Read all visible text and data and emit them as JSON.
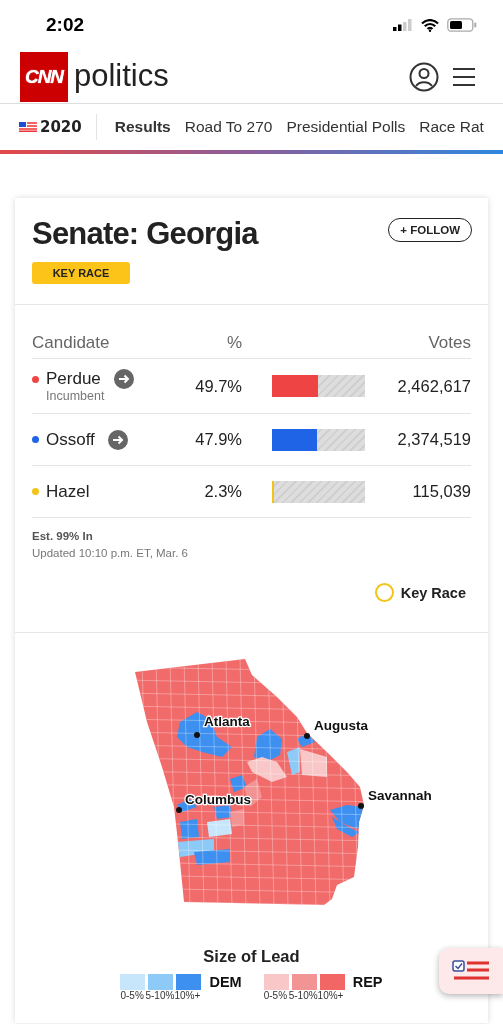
{
  "status_bar": {
    "time": "2:02"
  },
  "header": {
    "logo": "CNN",
    "section": "politics"
  },
  "nav": {
    "edition": "2020",
    "items": [
      {
        "label": "Results",
        "selected": true
      },
      {
        "label": "Road To 270",
        "selected": false
      },
      {
        "label": "Presidential Polls",
        "selected": false
      },
      {
        "label": "Race Rat",
        "selected": false
      }
    ]
  },
  "race": {
    "title": "Senate: Georgia",
    "badge": "KEY RACE",
    "follow": "+ FOLLOW",
    "columns": [
      "Candidate",
      "%",
      "Votes"
    ],
    "candidates": [
      {
        "name": "Perdue",
        "note": "Incumbent",
        "color": "#ef4444",
        "details_link": true,
        "percent": "49.7%",
        "level": 0.497,
        "votes": "2,462,617"
      },
      {
        "name": "Ossoff",
        "color": "#1f63e6",
        "details_link": true,
        "percent": "47.9%",
        "level": 0.479,
        "votes": "2,374,519"
      },
      {
        "name": "Hazel",
        "color": "#f2c318",
        "details_link": false,
        "percent": "2.3%",
        "level": 0.023,
        "votes": "115,039"
      }
    ],
    "reporting": "Est. 99% In",
    "updated": "Updated 10:10 p.m. ET, Mar. 6",
    "key_legend": "Key Race",
    "map": {
      "cities": [
        {
          "name": "Atlanta"
        },
        {
          "name": "Augusta"
        },
        {
          "name": "Columbus"
        },
        {
          "name": "Savannah"
        }
      ]
    },
    "lead_title": "Size of Lead",
    "lead_scales": [
      {
        "party": "DEM",
        "steps": [
          {
            "label": "0-5%",
            "color": "#c8e6fb"
          },
          {
            "label": "5-10%",
            "color": "#8dcaf8"
          },
          {
            "label": "10%+",
            "color": "#3d8ff0"
          }
        ]
      },
      {
        "party": "REP",
        "steps": [
          {
            "label": "0-5%",
            "color": "#f9c7c7"
          },
          {
            "label": "5-10%",
            "color": "#f39494"
          },
          {
            "label": "10%+",
            "color": "#f26666"
          }
        ]
      }
    ]
  }
}
